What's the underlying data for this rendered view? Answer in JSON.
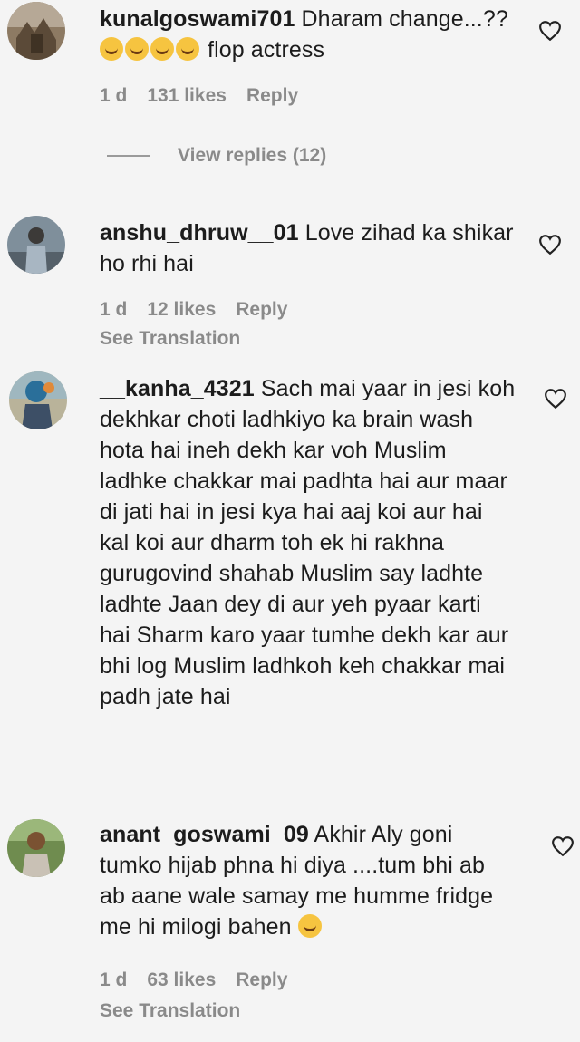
{
  "comments": [
    {
      "username": "kunalgoswami701",
      "text_before_emoji": "Dharam change...??",
      "text_after_emoji": "flop actress",
      "emoji_name": "face-with-tears-of-joy",
      "emoji_count": 4,
      "time": "1 d",
      "likes": "131 likes",
      "reply": "Reply",
      "view_replies": "View replies (12)"
    },
    {
      "username": "anshu_dhruw__01",
      "text": "Love zihad ka shikar ho rhi hai",
      "time": "1 d",
      "likes": "12 likes",
      "reply": "Reply",
      "see_translation": "See Translation"
    },
    {
      "username": "__kanha_4321",
      "text": "Sach mai yaar in jesi koh dekhkar choti ladhkiyo ka brain wash hota hai ineh dekh kar voh Muslim ladhke chakkar mai padhta hai aur maar di jati hai in jesi kya hai aaj koi aur hai kal koi aur dharm toh ek hi rakhna gurugovind shahab Muslim say ladhte ladhte Jaan dey di aur yeh pyaar karti hai Sharm karo yaar tumhe dekh kar aur bhi log Muslim ladhkoh keh chakkar mai padh jate hai"
    },
    {
      "username": "anant_goswami_09",
      "text": "Akhir Aly goni tumko hijab phna hi diya ....tum bhi ab ab aane wale samay me humme fridge me hi milogi bahen",
      "emoji_name": "crying-face",
      "time": "1 d",
      "likes": "63 likes",
      "reply": "Reply",
      "see_translation": "See Translation"
    }
  ],
  "icons": {
    "like": "heart-outline-icon"
  },
  "colors": {
    "meta_text": "#8a8a8a",
    "background": "#f4f4f4"
  }
}
